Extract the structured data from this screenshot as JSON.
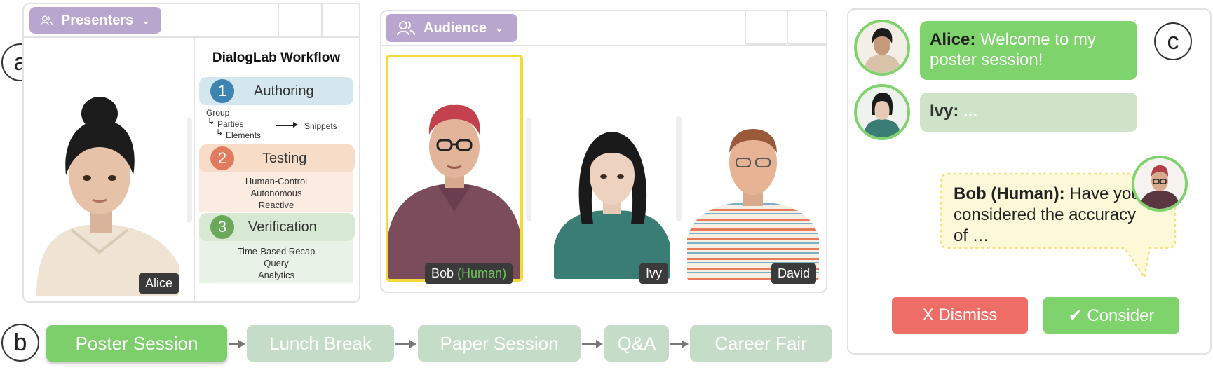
{
  "labels": {
    "a": "a",
    "b": "b",
    "c": "c"
  },
  "presenters": {
    "tag_label": "Presenters",
    "avatar_name": "Alice",
    "workflow": {
      "title": "DialogLab Workflow",
      "steps": [
        {
          "num": "1",
          "label": "Authoring",
          "color": "#3d85b0",
          "bg": "#d4e6ee"
        },
        {
          "num": "2",
          "label": "Testing",
          "color": "#e07b5e",
          "bg": "#f7dcc8"
        },
        {
          "num": "3",
          "label": "Verification",
          "color": "#6aa85a",
          "bg": "#d7e9d2"
        }
      ],
      "authoring": {
        "group": "Group",
        "parties": "Parties",
        "elements": "Elements",
        "snippets": "Snippets"
      },
      "testing_items": [
        "Human-Control",
        "Autonomous",
        "Reactive"
      ],
      "verification_items": [
        "Time-Based Recap",
        "Query",
        "Analytics"
      ]
    }
  },
  "audience": {
    "tag_label": "Audience",
    "members": [
      {
        "name": "Bob",
        "suffix": "(Human)"
      },
      {
        "name": "Ivy",
        "suffix": ""
      },
      {
        "name": "David",
        "suffix": ""
      }
    ]
  },
  "timeline": {
    "sessions": [
      "Poster Session",
      "Lunch Break",
      "Paper Session",
      "Q&A",
      "Career Fair"
    ]
  },
  "chat": {
    "messages": [
      {
        "speaker": "Alice:",
        "text": "Welcome to my poster session!"
      },
      {
        "speaker": "Ivy:",
        "text": "..."
      },
      {
        "speaker": "Bob (Human):",
        "text": "Have you considered the accuracy of …"
      }
    ],
    "dismiss_label": "X Dismiss",
    "consider_label": "✔ Consider"
  },
  "colors": {
    "tag": "#b8a6cf",
    "timeline_active": "#7dcf6b",
    "timeline_inactive": "#c5dcc8",
    "chat_alice": "#7fd36d",
    "chat_ivy": "#cfe3c9",
    "dismiss": "#ee6d66",
    "consider": "#7fd36d"
  }
}
